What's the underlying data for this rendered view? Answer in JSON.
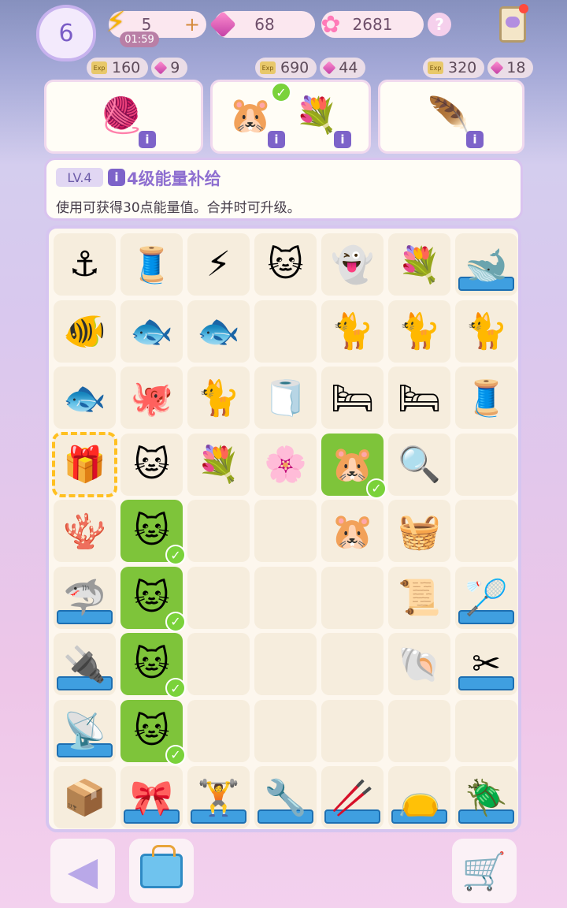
{
  "top_bar": {
    "level": "6",
    "energy": "5",
    "energy_timer": "01:59",
    "energy_plus": "+",
    "gems": "68",
    "rainbow": "2681",
    "help": "?"
  },
  "orders": [
    {
      "exp": "160",
      "gems": "9",
      "items": [
        "yarn-ball"
      ],
      "completed": [
        false
      ]
    },
    {
      "exp": "690",
      "gems": "44",
      "items": [
        "hamster-bottle",
        "flower-vase"
      ],
      "completed": [
        true,
        false
      ]
    },
    {
      "exp": "320",
      "gems": "18",
      "items": [
        "feather"
      ],
      "completed": [
        false
      ]
    }
  ],
  "info_panel": {
    "level_tag": "LV.4",
    "info_icon": "i",
    "title": "4级能量补给",
    "description": "使用可获得30点能量值。合并时可升级。"
  },
  "board": {
    "rows": [
      [
        "anchor",
        "thread-spool",
        "energy-bolts",
        "siamese-cat",
        "ghost",
        "flower-vase",
        "whale-tray"
      ],
      [
        "goldfish-white",
        "goldfish",
        "goldfish-small",
        "empty",
        "brown-cat-bow",
        "white-cat",
        "calico-cat-ghost"
      ],
      [
        "silver-fish",
        "purple-blob",
        "calico-cat-box",
        "towel-rolls",
        "blue-cat-bed",
        "blue-cat-bed-2",
        "pink-spool"
      ],
      [
        "energy-gift",
        "siamese-cat",
        "purple-bouquet",
        "purple-flower",
        "hamster-bottle",
        "magnifier",
        "empty"
      ],
      [
        "coral",
        "cream-cat",
        "empty",
        "empty",
        "pink-blanket",
        "basket",
        "empty"
      ],
      [
        "shark-fin-tray",
        "cream-cat",
        "empty",
        "empty",
        "empty",
        "paper-roll",
        "racket-tray"
      ],
      [
        "circuit-tray",
        "cream-cat",
        "empty",
        "empty",
        "empty",
        "shell-feather",
        "scissors-tray"
      ],
      [
        "dish-tray",
        "cream-cat",
        "empty",
        "empty",
        "empty",
        "empty",
        "empty"
      ],
      [
        "water-box",
        "bow-tray",
        "dumbbell-tray",
        "pliers-tray",
        "tongs-tray",
        "pouch-tray",
        "beetle-tray"
      ]
    ],
    "done_cells": [
      [
        3,
        4
      ],
      [
        4,
        1
      ],
      [
        5,
        1
      ],
      [
        6,
        1
      ],
      [
        7,
        1
      ]
    ],
    "selected_cell": [
      3,
      0
    ]
  }
}
